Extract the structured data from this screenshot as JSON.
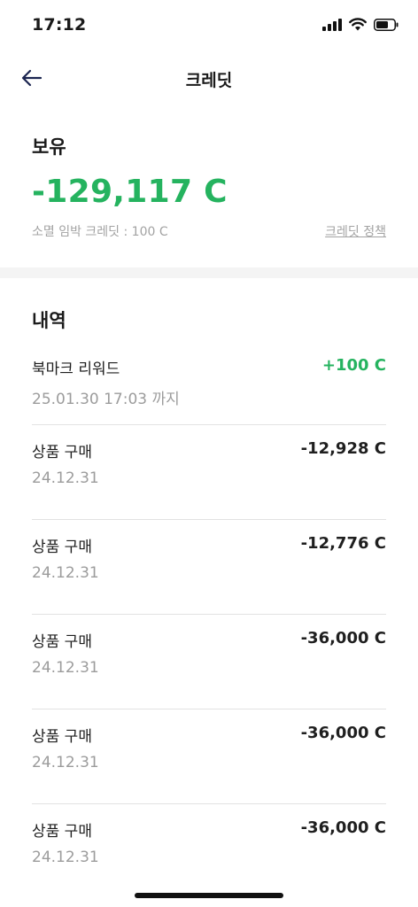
{
  "status_bar": {
    "time": "17:12"
  },
  "header": {
    "title": "크레딧",
    "back_icon": "arrow-left-icon"
  },
  "balance": {
    "heading": "보유",
    "amount": "-129,117 C",
    "expiring_text": "소멸 임박 크레딧 : 100 C",
    "policy_link": "크레딧 정책",
    "accent_color": "#25b35f"
  },
  "history": {
    "heading": "내역",
    "items": [
      {
        "title": "북마크 리워드",
        "date": "25.01.30 17:03 까지",
        "amount": "+100 C"
      },
      {
        "title": "상품 구매",
        "date": "24.12.31",
        "amount": "-12,928 C"
      },
      {
        "title": "상품 구매",
        "date": "24.12.31",
        "amount": "-12,776 C"
      },
      {
        "title": "상품 구매",
        "date": "24.12.31",
        "amount": "-36,000 C"
      },
      {
        "title": "상품 구매",
        "date": "24.12.31",
        "amount": "-36,000 C"
      },
      {
        "title": "상품 구매",
        "date": "24.12.31",
        "amount": "-36,000 C"
      }
    ]
  }
}
